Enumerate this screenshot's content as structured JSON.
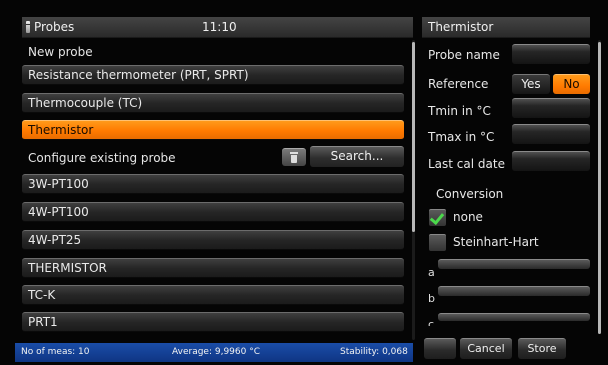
{
  "header": {
    "title": "Probes",
    "time": "11:10"
  },
  "new_probe": {
    "section_label": "New probe",
    "options": [
      {
        "label": "Resistance thermometer (PRT, SPRT)",
        "selected": false
      },
      {
        "label": "Thermocouple (TC)",
        "selected": false
      },
      {
        "label": "Thermistor",
        "selected": true
      }
    ]
  },
  "existing_probes": {
    "section_label": "Configure existing probe",
    "search_label": "Search...",
    "items": [
      "3W-PT100",
      "4W-PT100",
      "4W-PT25",
      "THERMISTOR",
      "TC-K",
      "PRT1"
    ]
  },
  "status": {
    "measurements": "No of meas: 10",
    "average": "Average: 9,9960 °C",
    "stability": "Stability: 0,068"
  },
  "details": {
    "title": "Thermistor",
    "probe_name_label": "Probe name",
    "reference_label": "Reference",
    "yes_label": "Yes",
    "no_label": "No",
    "tmin_label": "Tmin in °C",
    "tmax_label": "Tmax in °C",
    "last_cal_label": "Last cal date",
    "conversion_label": "Conversion",
    "conversion_options": [
      {
        "label": "none",
        "checked": true
      },
      {
        "label": "Steinhart-Hart",
        "checked": false
      }
    ],
    "coefficients": [
      "a",
      "b",
      "c"
    ],
    "cancel_label": "Cancel",
    "store_label": "Store"
  },
  "colors": {
    "accent": "#ff7f00",
    "status_bar": "#123b8f",
    "check": "#4bd84b"
  }
}
